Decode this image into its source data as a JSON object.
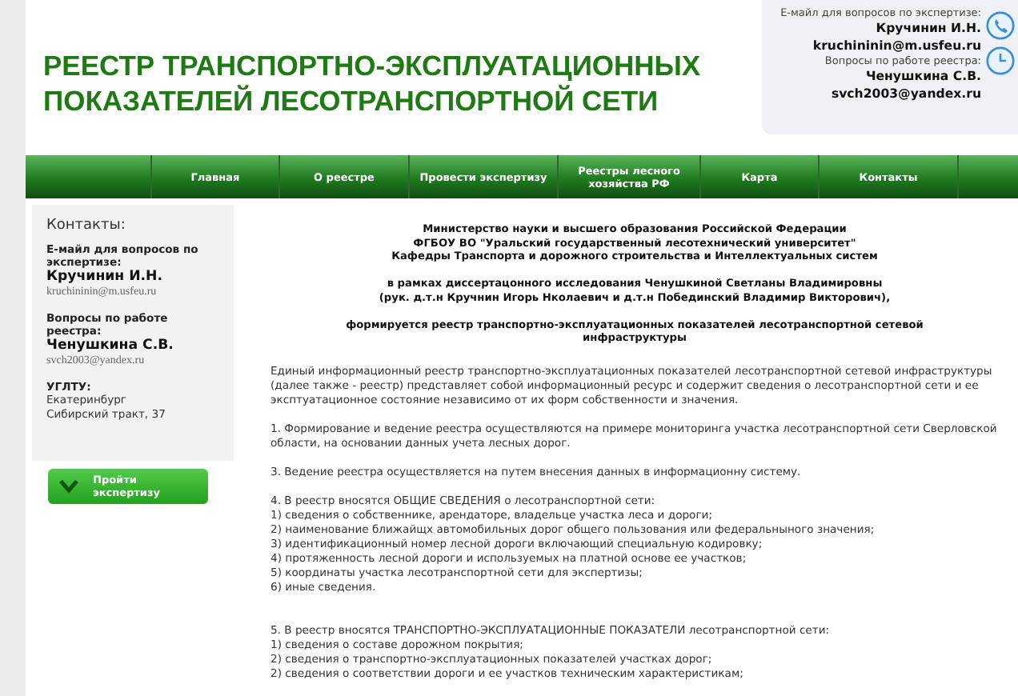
{
  "header": {
    "title_lines": [
      "РЕЕСТР ТРАНСПОРТНО-ЭКСПЛУАТАЦИОННЫХ",
      "ПОКАЗАТЕЛЕЙ ЛЕСОТРАНСПОРТНОЙ СЕТИ"
    ],
    "contacts": [
      {
        "kind": "label",
        "text": "E-майл для вопросов по экспертизе:"
      },
      {
        "kind": "name",
        "text": "Кручинин И.Н."
      },
      {
        "kind": "email",
        "text": "kruchininin@m.usfeu.ru"
      },
      {
        "kind": "label",
        "text": "Вопросы по работе реестра:"
      },
      {
        "kind": "name",
        "text": "Ченушкина С.В."
      },
      {
        "kind": "email",
        "text": "svch2003@yandex.ru"
      }
    ]
  },
  "nav": {
    "items": [
      "Главная",
      "О реестре",
      "Провести экспертизу",
      "Реестры лесного хозяйства РФ",
      "Карта",
      "Контакты"
    ]
  },
  "sidebar": {
    "heading": "Контакты:",
    "blocks": [
      {
        "label": "E-майл для вопросов по экспертизе:",
        "name": "Кручинин И.Н.",
        "email": "kruchininin@m.usfeu.ru"
      },
      {
        "label": "Вопросы по работе реестра:",
        "name": "Ченушкина С.В.",
        "email": "svch2003@yandex.ru"
      }
    ],
    "address": {
      "label": "УГЛТУ:",
      "lines": [
        "Екатеринбург",
        "Сибирский тракт, 37"
      ]
    },
    "button": "Пройти экспертизу"
  },
  "content": {
    "intro": [
      {
        "lines": [
          "Министерство науки и высшего образования Российской Федерации",
          "ФГБОУ ВО \"Уральский государственный лесотехнический университет\"",
          "Кафедры Транспорта и дорожного строительства и Интеллектуальных систем"
        ]
      },
      {
        "lines": [
          "в рамках диссертацонного исследования Ченушкиной Светланы Владимировны",
          "(рук. д.т.н Кручнин Игорь Нколаевич и д.т.н Побединский Владимир Викторович),"
        ]
      },
      {
        "lines": [
          "формируется реестр транспортно-эксплуатационных показателей лесотранспортной сетевой инфраструктуры"
        ]
      }
    ],
    "blocks": [
      {
        "kind": "paragraph",
        "text": "Единый информационный реестр транспортно-эксплуатационных показателей лесотранспортной сетевой инфраструктуры (далее также - реестр) представляет собой информационный ресурс и содержит сведения о лесотранспортной сети и ее эксптуатационное состояние независимо от их форм собственности и значения."
      },
      {
        "kind": "paragraph",
        "text": "1. Формирование и ведение реестра осуществляются на примере мониторинга участка лесотранспортной сети Сверловской области, на основании данных учета лесных дорог."
      },
      {
        "kind": "paragraph",
        "text": "3. Ведение реестра осуществляется на путем внесения данных в информационну систему."
      },
      {
        "kind": "list",
        "lines": [
          "4. В реестр вносятся ОБЩИЕ СВЕДЕНИЯ о лесотранспортной сети:",
          "1) сведения о собственнике, арендаторе, владельце участка леса и дороги;",
          "2) наименование ближайщх автомобильных дорог общего пользования или федеральныного значения;",
          "3) идентификационный номер лесной дороги включающий специальную кодировку;",
          "4) протяженность лесной дороги и используемых на платной основе ее участков;",
          "5) координаты участка лесотранспортной сети для экспертизы;",
          "6) иные сведения."
        ]
      },
      {
        "kind": "list",
        "lines": [
          "5. В реестр вносятся ТРАНСПОРТНО-ЭКСПЛУАТАЦИОННЫЕ ПОКАЗАТЕЛИ лесотранспортной сети:",
          "1) сведения о составе дорожном покрытия;",
          "2) сведения о транспортно-эксплуатационных показателей участках дорог;",
          "2) сведения о соответствии дороги и ее участков техническим характеристикам;"
        ]
      }
    ]
  }
}
